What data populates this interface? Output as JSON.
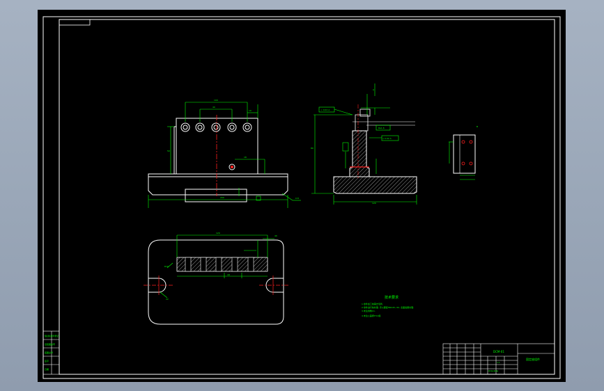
{
  "app": {
    "title": ""
  },
  "colors": {
    "background": "#9aa7b8",
    "sheet": "#000000",
    "frame": "#ffffff",
    "geometry": "#ffffff",
    "dimension": "#00ff00",
    "centerline": "#ff2020",
    "hatch": "#ffffff",
    "notes": "#00ff00",
    "accent_cyan": "#00ffff"
  },
  "drawing": {
    "notes_title": "技术要求",
    "notes": [
      "1.零件加工前需去毛刺.",
      "2.零件进行热处理, 淬火硬度HRC45~50, 表面发黑处理.",
      "3.未注倒角C1.",
      "4.未注公差按IT12级."
    ],
    "title_block": {
      "drawing_name": "固定座组件",
      "part_number": "DCM-01",
      "scale": "1:1",
      "sheet_label": "共1张 第1张"
    },
    "left_column_labels": [
      "借(通)用件登记",
      "旧底图总号",
      "底图总号",
      "签字",
      "日期"
    ]
  }
}
